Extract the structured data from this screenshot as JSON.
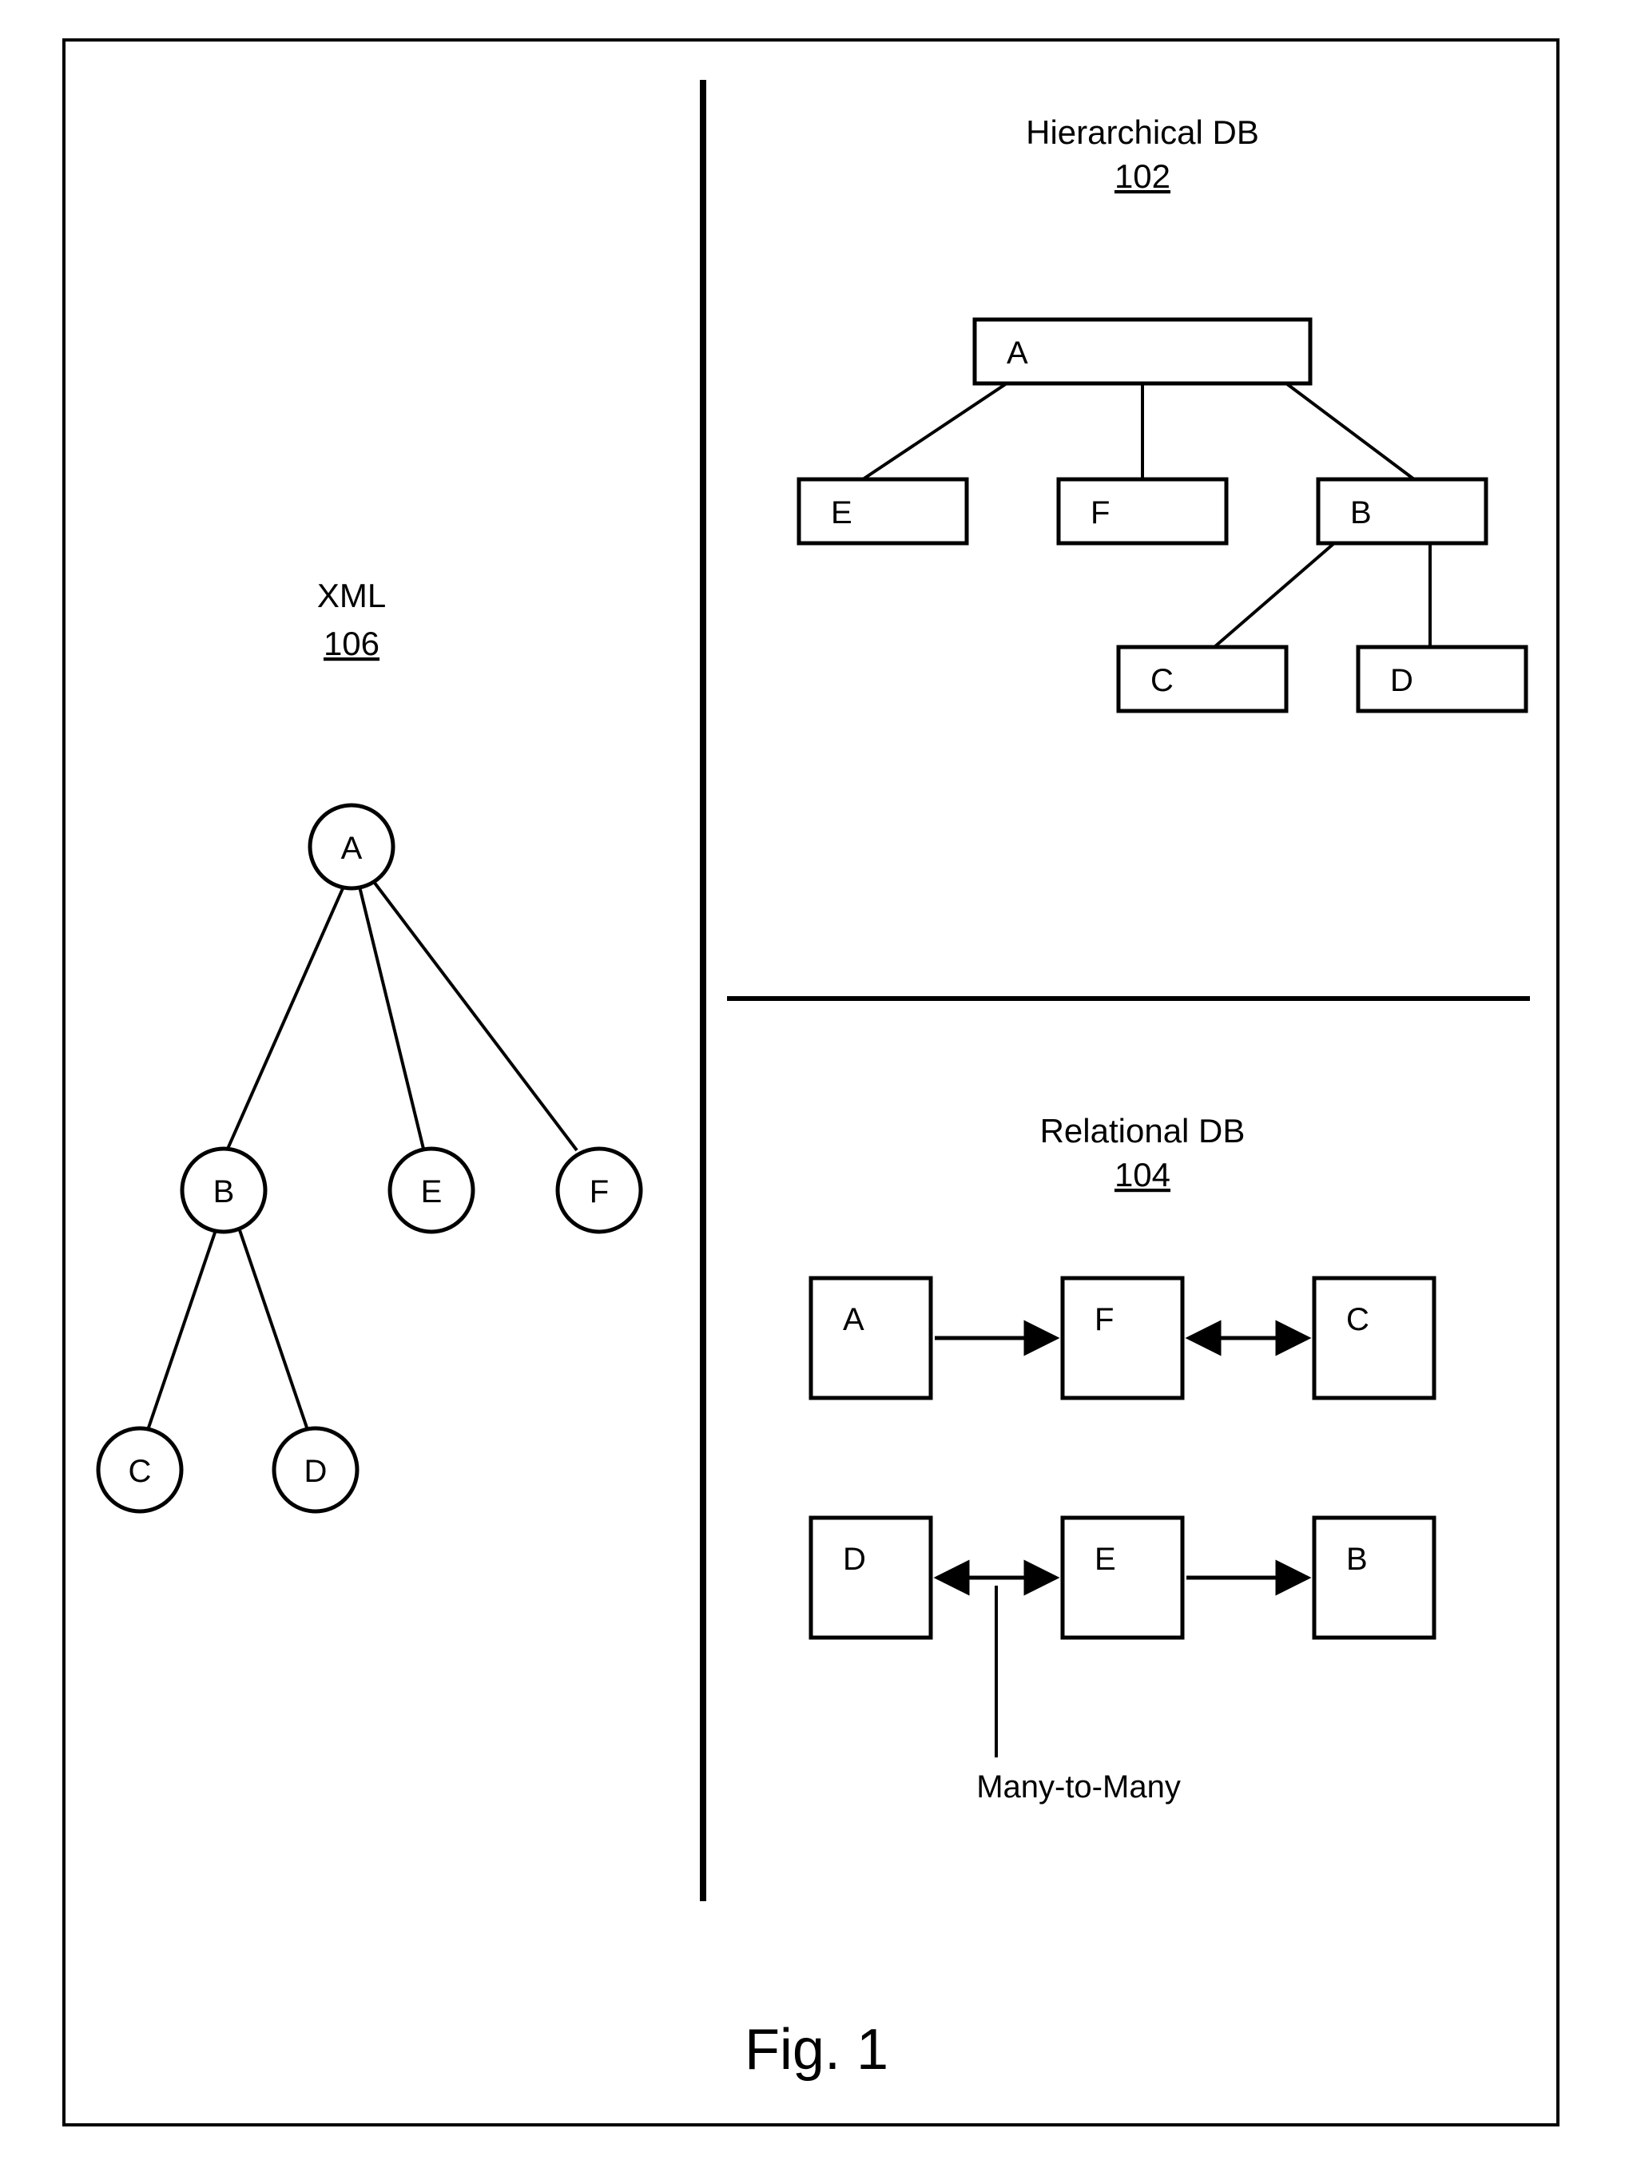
{
  "figure_caption": "Fig. 1",
  "xml": {
    "title": "XML",
    "ref": "106",
    "nodes": {
      "a": "A",
      "b": "B",
      "c": "C",
      "d": "D",
      "e": "E",
      "f": "F"
    }
  },
  "hier": {
    "title": "Hierarchical DB",
    "ref": "102",
    "nodes": {
      "a": "A",
      "b": "B",
      "c": "C",
      "d": "D",
      "e": "E",
      "f": "F"
    }
  },
  "rel": {
    "title": "Relational DB",
    "ref": "104",
    "nodes": {
      "a": "A",
      "b": "B",
      "c": "C",
      "d": "D",
      "e": "E",
      "f": "F"
    },
    "note": "Many-to-Many"
  }
}
